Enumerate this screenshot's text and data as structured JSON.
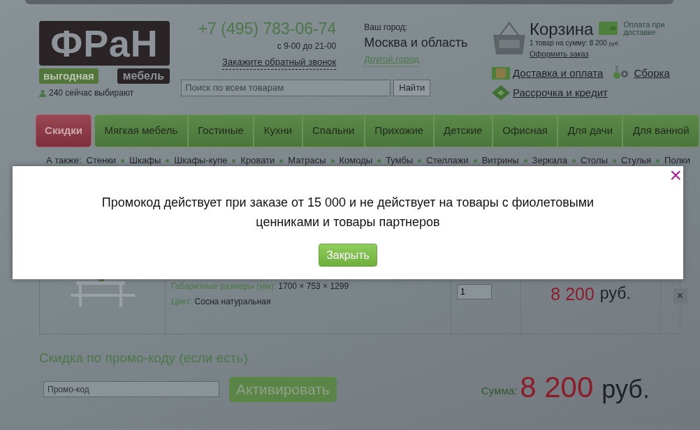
{
  "logo": {
    "word": "ФРаН",
    "tag_left": "выгодная",
    "tag_right": "мебель"
  },
  "online": "240 сейчас выбирают",
  "phone": {
    "number": "+7 (495) 783-06-74",
    "hours": "с 9-00 до 21-00",
    "callback": "Закажите обратный звонок"
  },
  "search": {
    "placeholder": "Поиск по всем товарам",
    "button": "Найти"
  },
  "city": {
    "label": "Ваш город:",
    "name": "Москва и область",
    "change": "Другой город"
  },
  "cart": {
    "title": "Корзина",
    "summary": "1 товар на сумму: 8 200",
    "currency": "руб.",
    "checkout": "Оформить заказ",
    "payment_note": "Оплата при доставке"
  },
  "info_links": [
    {
      "label": "Доставка и оплата",
      "kind": "delivery"
    },
    {
      "label": "Сборка",
      "kind": "assembly"
    },
    {
      "label": "Рассрочка и кредит",
      "kind": "credit"
    }
  ],
  "nav": [
    {
      "label": "Скидки",
      "kind": "sale"
    },
    {
      "label": "Мягкая мебель",
      "kind": "main"
    },
    {
      "label": "Гостиные",
      "kind": "main"
    },
    {
      "label": "Кухни",
      "kind": "main"
    },
    {
      "label": "Спальни",
      "kind": "main"
    },
    {
      "label": "Прихожие",
      "kind": "main"
    },
    {
      "label": "Детские",
      "kind": "main"
    },
    {
      "label": "Офисная",
      "kind": "main"
    },
    {
      "label": "Для дачи",
      "kind": "main"
    },
    {
      "label": "Для ванной",
      "kind": "main"
    }
  ],
  "also": {
    "label": "А также:",
    "items": [
      "Стенки",
      "Шкафы",
      "Шкафы-купе",
      "Кровати",
      "Матрасы",
      "Комоды",
      "Тумбы",
      "Стеллажи",
      "Витрины",
      "Зеркала",
      "Столы",
      "Стулья",
      "Полки"
    ]
  },
  "cart_row": {
    "dims_label": "Габаритные размеры (мм):",
    "dims": "1700 × 753 × 1299",
    "color_label": "Цвет:",
    "color_name": "Сосна натуральная",
    "qty": "1",
    "price": "8 200",
    "currency": "руб.",
    "remove": "×"
  },
  "promo": {
    "title": "Скидка по промо-коду (если есть)",
    "placeholder": "Промо-код",
    "button": "Активировать"
  },
  "total": {
    "label": "Сумма:",
    "value": "8 200",
    "currency": "руб."
  },
  "modal": {
    "message": "Промокод действует при заказе от 15 000 и не действует на товары с фиолетовыми ценниками и товары партнеров",
    "button": "Закрыть",
    "close": "×"
  }
}
